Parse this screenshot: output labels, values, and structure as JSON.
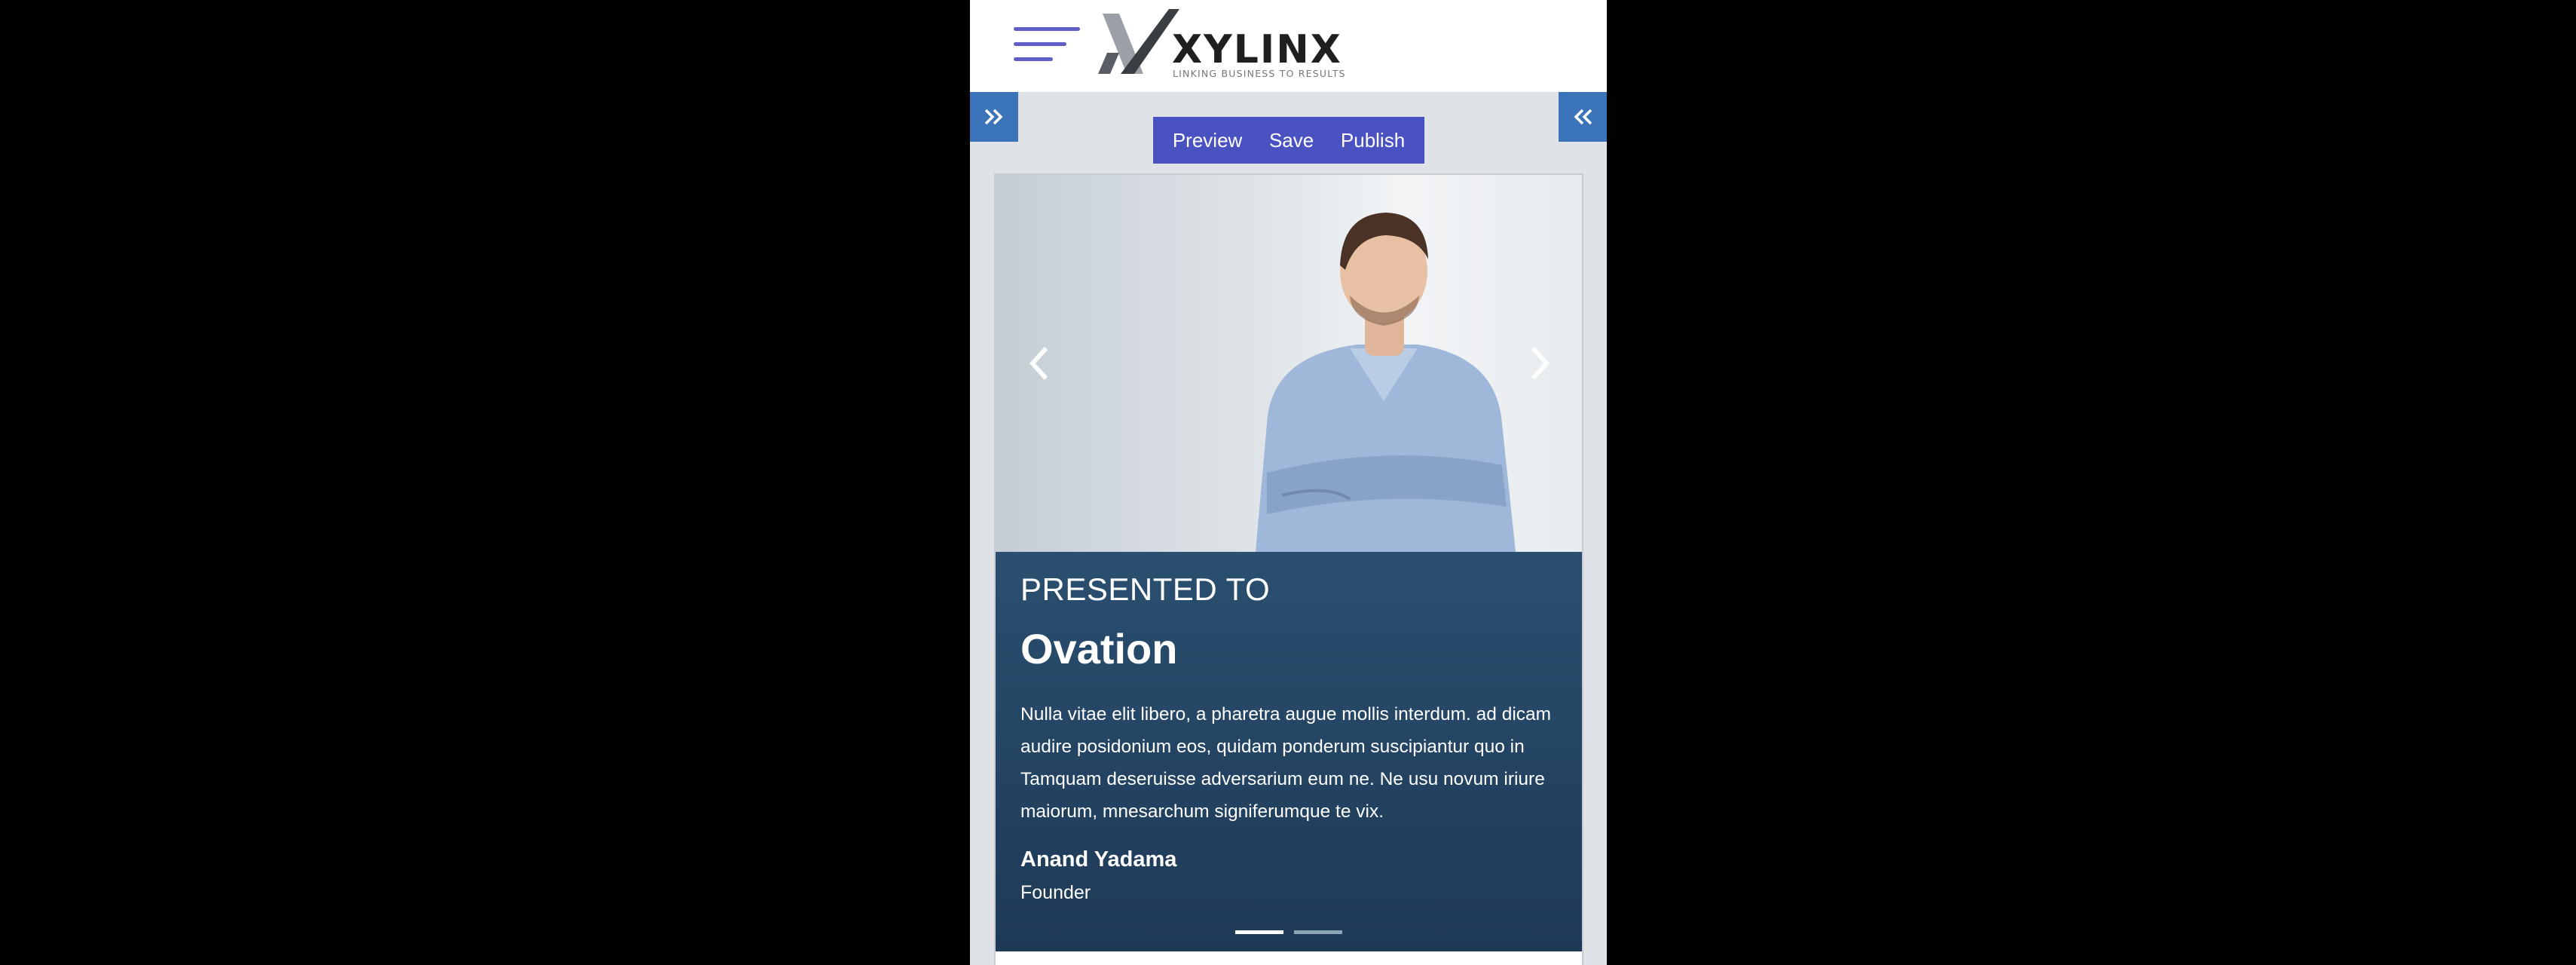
{
  "header": {
    "brand": "XYLINX",
    "tagline": "LINKING BUSINESS TO RESULTS"
  },
  "icons": {
    "menu": "hamburger-menu-icon",
    "expand_left": "double-chevron-right-icon",
    "collapse_right": "double-chevron-left-icon",
    "carousel_prev": "chevron-left-icon",
    "carousel_next": "chevron-right-icon"
  },
  "toolbar": {
    "preview_label": "Preview",
    "save_label": "Save",
    "publish_label": "Publish"
  },
  "slide": {
    "eyebrow": "PRESENTED TO",
    "title": "Ovation",
    "body": "Nulla vitae elit libero, a pharetra augue mollis interdum. ad dicam audire posidonium eos, quidam ponderum suscipiantur quo in Tamquam deseruisse adversarium eum ne. Ne usu novum iriure maiorum, mnesarchum signiferumque te vix.",
    "author": "Anand Yadama",
    "role": "Founder"
  },
  "carousel": {
    "total_slides": 2,
    "active_index": 0
  },
  "colors": {
    "accent_blue": "#3b74b8",
    "toolbar_indigo": "#4a52c2",
    "caption_navy": "#25445f",
    "menu_purple": "#5d5fc4"
  }
}
